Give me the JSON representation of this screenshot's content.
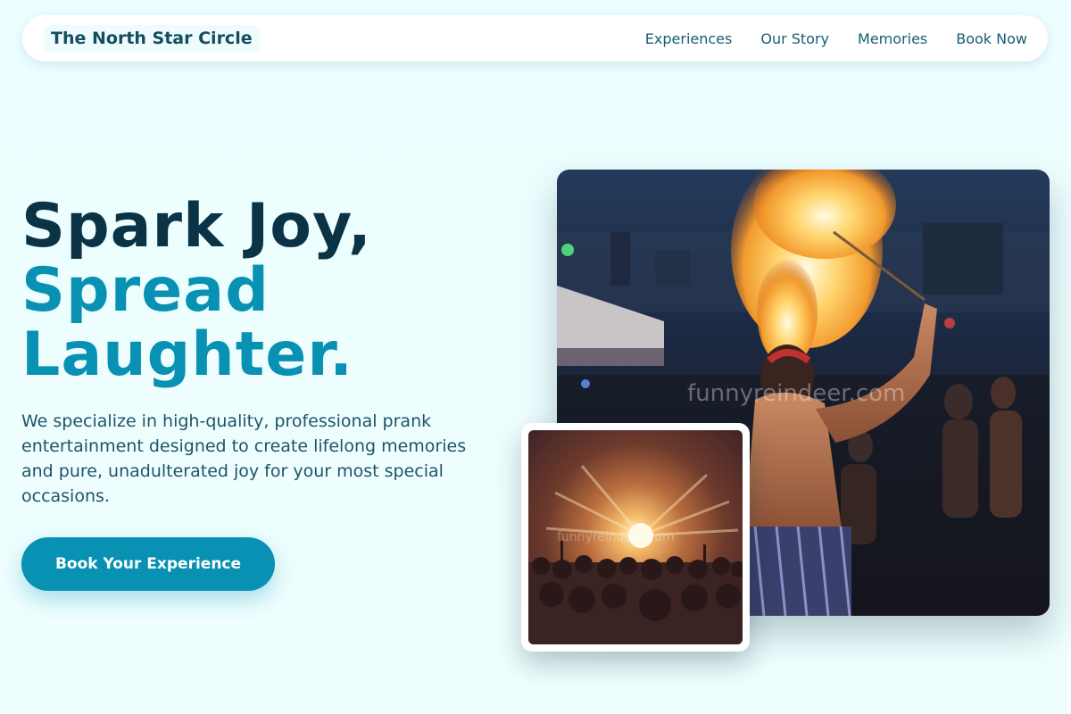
{
  "header": {
    "brand": "The North Star Circle",
    "nav": [
      "Experiences",
      "Our Story",
      "Memories",
      "Book Now"
    ]
  },
  "hero": {
    "title_line1": "Spark Joy,",
    "title_line2": "Spread",
    "title_line3": "Laughter.",
    "description": "We specialize in high-quality, professional prank entertainment designed to create lifelong memories and pure, unadulterated joy for your most special occasions.",
    "cta_label": "Book Your Experience"
  },
  "images": {
    "main_watermark": "funnyreindeer.com",
    "inset_watermark": "funnyreindeer.com"
  },
  "colors": {
    "background": "#ecfeff",
    "brand_text": "#134e5e",
    "title_dark": "#0b3346",
    "accent": "#0891b2"
  }
}
